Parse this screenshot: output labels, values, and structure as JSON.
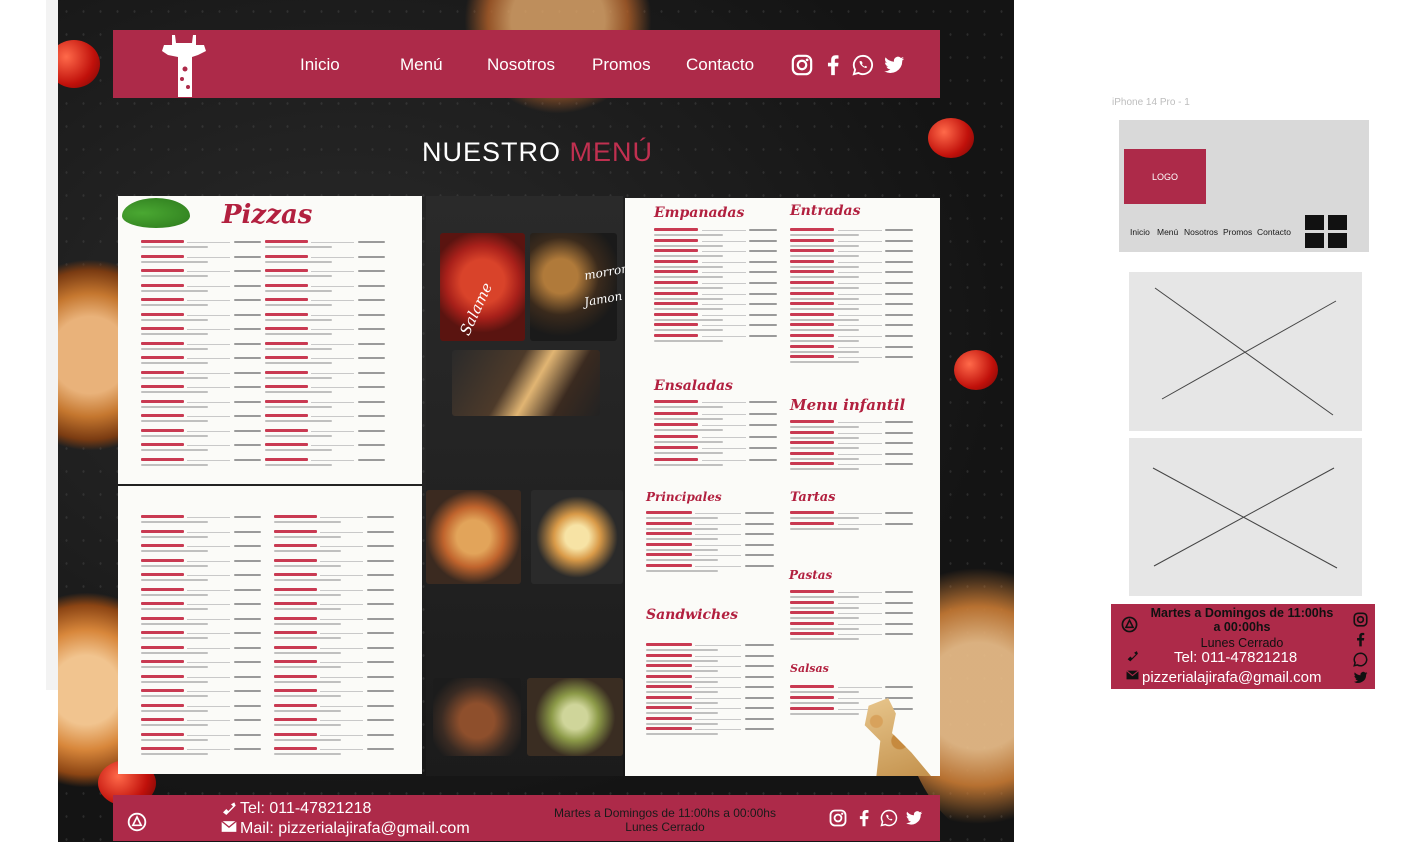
{
  "nav": {
    "items": [
      "Inicio",
      "Menú",
      "Nosotros",
      "Promos",
      "Contacto"
    ],
    "social_icons": [
      "instagram-icon",
      "facebook-icon",
      "whatsapp-icon",
      "twitter-icon"
    ]
  },
  "menu_title": {
    "main": "NUESTRO",
    "accent": "MENÚ"
  },
  "sheets": {
    "pizzas_heading": "Pizzas",
    "empanadas_heading": "Empanadas",
    "entradas_heading": "Entradas",
    "ensaladas_heading": "Ensaladas",
    "menu_infantil_heading": "Menu infantil",
    "principales_heading": "Principales",
    "tartas_heading": "Tartas",
    "pastas_heading": "Pastas",
    "sandwiches_heading": "Sandwiches",
    "salsas_heading": "Salsas",
    "photo_word_a": "morron",
    "photo_word_b": "Salame",
    "photo_word_c": "Jamon"
  },
  "footer": {
    "phone": "Tel: 011-47821218",
    "email": "Mail: pizzerialajirafa@gmail.com",
    "hours": "Martes a Domingos de 11:00hs a 00:00hs",
    "closed": "Lunes Cerrado"
  },
  "mobile": {
    "label": "iPhone 14 Pro - 1",
    "logo": "LOGO",
    "nav": [
      "Inicio",
      "Menú",
      "Nosotros",
      "Promos",
      "Contacto"
    ],
    "hours_line1": "Martes a Domingos de 11:00hs",
    "hours_line2": "a 00:00hs",
    "closed": "Lunes Cerrado",
    "phone": "Tel: 011-47821218",
    "email": "pizzerialajirafa@gmail.com"
  },
  "colors": {
    "brand": "#ad2a49",
    "accent_text": "#c03050",
    "placeholder": "#d9d9d9"
  }
}
